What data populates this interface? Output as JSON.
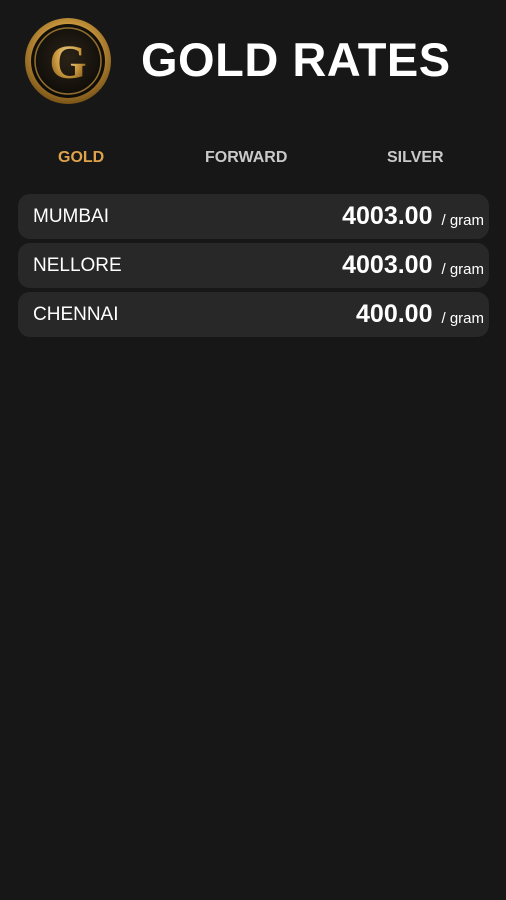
{
  "header": {
    "title": "GOLD RATES",
    "logo_icon": "gold-g-coin-icon",
    "logo_letter": "G"
  },
  "tabs": [
    {
      "label": "GOLD",
      "active": true
    },
    {
      "label": "FORWARD",
      "active": false
    },
    {
      "label": "SILVER",
      "active": false
    }
  ],
  "rates": [
    {
      "city": "MUMBAI",
      "price": "4003.00",
      "unit": "/ gram"
    },
    {
      "city": "NELLORE",
      "price": "4003.00",
      "unit": "/ gram"
    },
    {
      "city": "CHENNAI",
      "price": "400.00",
      "unit": "/ gram"
    }
  ],
  "colors": {
    "background": "#171717",
    "row_background": "#282828",
    "active_tab": "#e0a24a",
    "inactive_tab": "#c9c9c9",
    "text": "#ffffff",
    "gold_accent": "#c9a04a"
  }
}
